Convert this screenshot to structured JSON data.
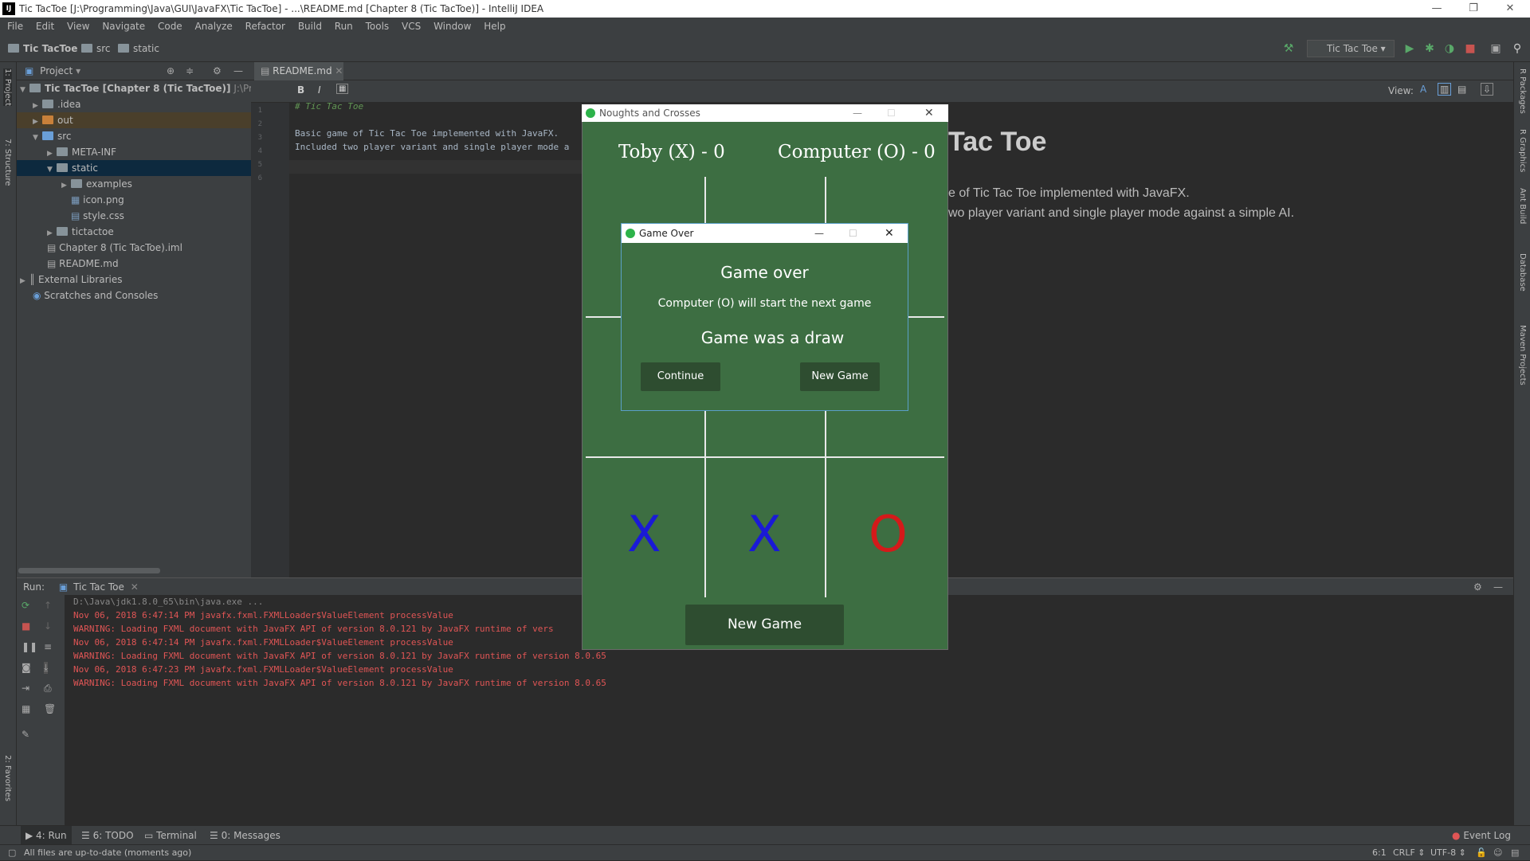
{
  "window": {
    "title": "Tic TacToe [J:\\Programming\\Java\\GUI\\JavaFX\\Tic TacToe] - ...\\README.md [Chapter 8 (Tic TacToe)] - IntelliJ IDEA"
  },
  "menu": [
    "File",
    "Edit",
    "View",
    "Navigate",
    "Code",
    "Analyze",
    "Refactor",
    "Build",
    "Run",
    "Tools",
    "VCS",
    "Window",
    "Help"
  ],
  "breadcrumb": {
    "project": "Tic TacToe",
    "src": "src",
    "static": "static"
  },
  "run_config": "Tic Tac Toe",
  "project_panel": {
    "title": "Project",
    "root": "Tic TacToe [Chapter 8 (Tic TacToe)]",
    "root_path": "J:\\Program",
    "items": [
      ".idea",
      "out",
      "src",
      "META-INF",
      "static",
      "examples",
      "icon.png",
      "style.css",
      "tictactoe",
      "Chapter 8 (Tic TacToe).iml",
      "README.md",
      "External Libraries",
      "Scratches and Consoles"
    ]
  },
  "editor": {
    "tab": "README.md",
    "lines": [
      "# Tic Tac Toe",
      "",
      "Basic game of Tic Tac Toe implemented with JavaFX.",
      "Included two player variant and single player mode a",
      "",
      ""
    ],
    "line_numbers": [
      "1",
      "2",
      "3",
      "4",
      "5",
      "6"
    ]
  },
  "preview": {
    "view_label": "View:",
    "heading": "Tac Toe",
    "line1": "e of Tic Tac Toe implemented with JavaFX.",
    "line2": "wo player variant and single player mode against a simple AI."
  },
  "run_panel": {
    "label": "Run:",
    "tab": "Tic Tac Toe",
    "console": [
      {
        "text": "D:\\Java\\jdk1.8.0_65\\bin\\java.exe ...",
        "kind": "cmd"
      },
      {
        "text": "Nov 06, 2018 6:47:14 PM javafx.fxml.FXMLLoader$ValueElement processValue",
        "kind": "err"
      },
      {
        "text": "WARNING: Loading FXML document with JavaFX API of version 8.0.121 by JavaFX runtime of vers",
        "kind": "err"
      },
      {
        "text": "Nov 06, 2018 6:47:14 PM javafx.fxml.FXMLLoader$ValueElement processValue",
        "kind": "err"
      },
      {
        "text": "WARNING: Loading FXML document with JavaFX API of version 8.0.121 by JavaFX runtime of version 8.0.65",
        "kind": "err"
      },
      {
        "text": "Nov 06, 2018 6:47:23 PM javafx.fxml.FXMLLoader$ValueElement processValue",
        "kind": "err"
      },
      {
        "text": "WARNING: Loading FXML document with JavaFX API of version 8.0.121 by JavaFX runtime of version 8.0.65",
        "kind": "err"
      }
    ]
  },
  "side_tabs": {
    "left": [
      "1: Project",
      "7: Structure",
      "2: Favorites"
    ],
    "right": [
      "R Packages",
      "R Graphics",
      "Ant Build",
      "Database",
      "Maven Projects"
    ]
  },
  "bottom_tabs": [
    "4: Run",
    "6: TODO",
    "Terminal",
    "0: Messages"
  ],
  "event_log": "Event Log",
  "status": {
    "message": "All files are up-to-date (moments ago)",
    "position": "6:1",
    "line_sep": "CRLF",
    "encoding": "UTF-8"
  },
  "game": {
    "title": "Noughts and Crosses",
    "player_score": "Toby (X) - 0",
    "computer_score": "Computer (O) - 0",
    "board_bottom_row": [
      "X",
      "X",
      "O"
    ],
    "new_game": "New Game"
  },
  "dialog": {
    "title": "Game Over",
    "heading": "Game over",
    "message": "Computer (O) will start the next game",
    "result": "Game was a draw",
    "continue": "Continue",
    "new_game": "New Game"
  },
  "colors": {
    "x": "#1a1ad6",
    "o": "#d41a1a",
    "board": "#3d6e42",
    "button": "#2e4d30"
  }
}
